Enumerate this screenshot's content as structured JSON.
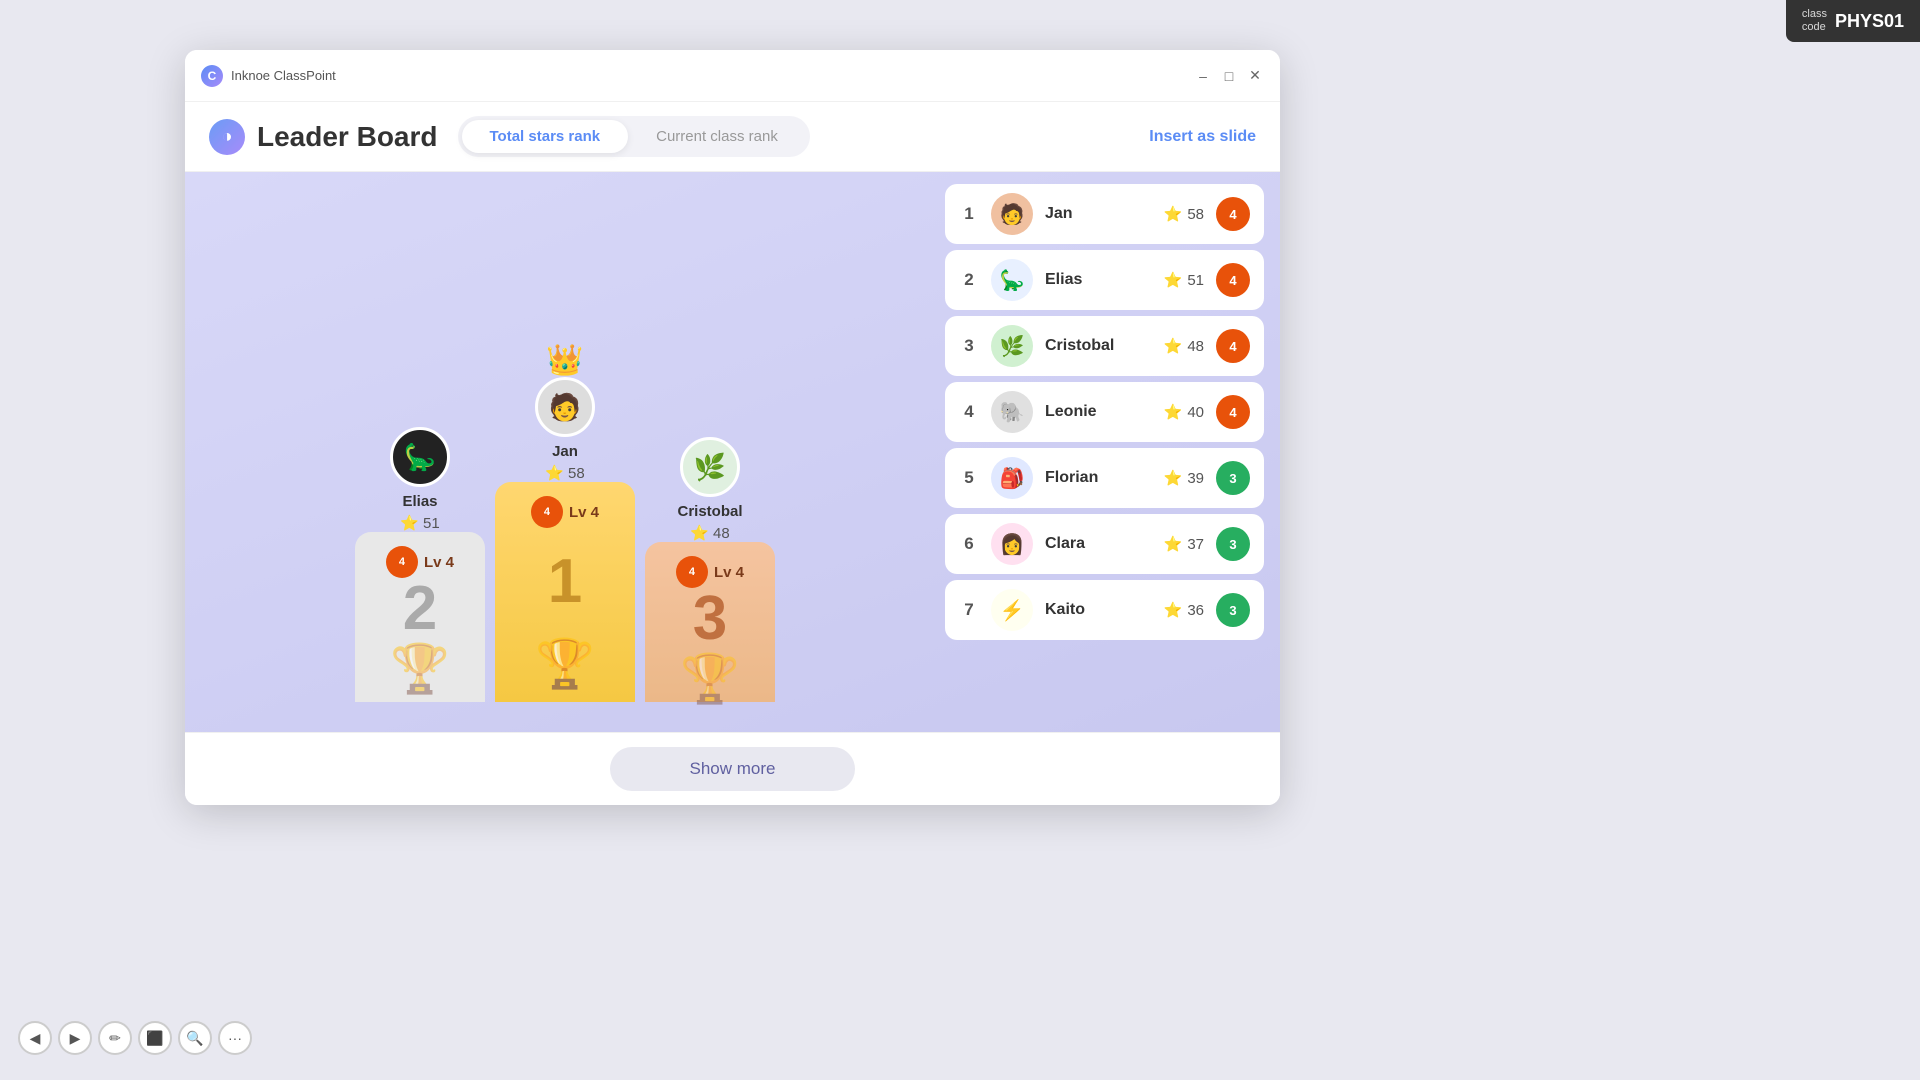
{
  "classcode": {
    "label": "class\ncode",
    "value": "PHYS01"
  },
  "titlebar": {
    "app_name": "Inknoe ClassPoint",
    "minimize": "–",
    "maximize": "□",
    "close": "✕"
  },
  "header": {
    "title": "Leader Board",
    "tab_active": "Total stars rank",
    "tab_inactive": "Current class rank",
    "insert_slide": "Insert as slide"
  },
  "podium": {
    "first": {
      "name": "Jan",
      "stars": 58,
      "level": 4,
      "rank": 1,
      "avatar_emoji": "🧑"
    },
    "second": {
      "name": "Elias",
      "stars": 51,
      "level": 4,
      "rank": 2,
      "avatar_emoji": "🦕"
    },
    "third": {
      "name": "Cristobal",
      "stars": 48,
      "level": 4,
      "rank": 3,
      "avatar_emoji": "🌿"
    }
  },
  "leaderboard": [
    {
      "rank": 1,
      "name": "Jan",
      "stars": 58,
      "level": 4,
      "level_color": "lv-4",
      "avatar": "🧑"
    },
    {
      "rank": 2,
      "name": "Elias",
      "stars": 51,
      "level": 4,
      "level_color": "lv-4",
      "avatar": "🦕"
    },
    {
      "rank": 3,
      "name": "Cristobal",
      "stars": 48,
      "level": 4,
      "level_color": "lv-4",
      "avatar": "🌿"
    },
    {
      "rank": 4,
      "name": "Leonie",
      "stars": 40,
      "level": 4,
      "level_color": "lv-4",
      "avatar": "🐘"
    },
    {
      "rank": 5,
      "name": "Florian",
      "stars": 39,
      "level": 3,
      "level_color": "lv-3",
      "avatar": "🎒"
    },
    {
      "rank": 6,
      "name": "Clara",
      "stars": 37,
      "level": 3,
      "level_color": "lv-3",
      "avatar": "👩"
    },
    {
      "rank": 7,
      "name": "Kaito",
      "stars": 36,
      "level": 3,
      "level_color": "lv-3",
      "avatar": "⚡"
    }
  ],
  "show_more": "Show more",
  "toolbar": {
    "back": "◀",
    "play": "▶",
    "pen": "✏",
    "screen": "⬛",
    "search": "🔍",
    "dots": "···"
  },
  "star_emoji": "⭐",
  "crown_emoji": "👑"
}
